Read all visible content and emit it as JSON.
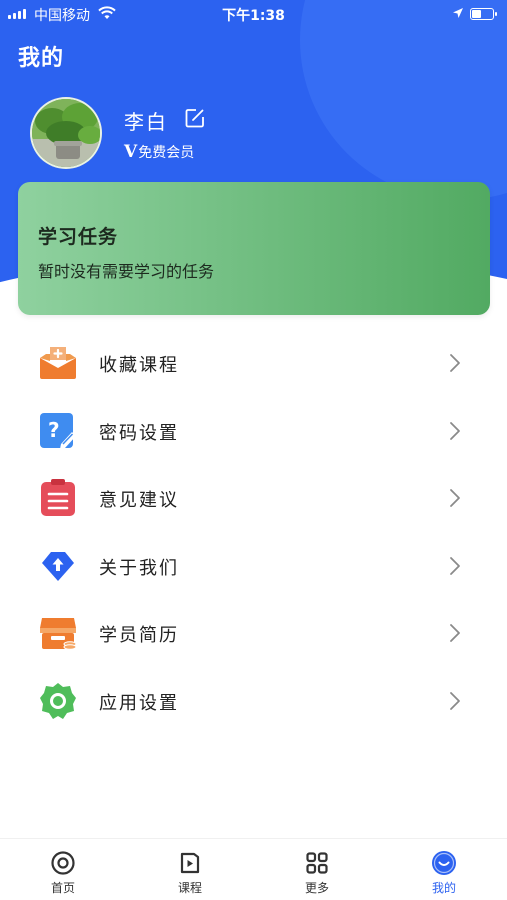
{
  "status_bar": {
    "carrier": "中国移动",
    "time": "下午1:38"
  },
  "header": {
    "title": "我的"
  },
  "profile": {
    "name": "李白",
    "membership": "免费会员",
    "vip_mark": "V"
  },
  "task_card": {
    "title": "学习任务",
    "description": "暂时没有需要学习的任务"
  },
  "menu": {
    "items": [
      {
        "label": "收藏课程",
        "icon": "favorite-course-icon"
      },
      {
        "label": "密码设置",
        "icon": "password-settings-icon"
      },
      {
        "label": "意见建议",
        "icon": "feedback-icon"
      },
      {
        "label": "关于我们",
        "icon": "about-us-icon"
      },
      {
        "label": "学员简历",
        "icon": "student-resume-icon"
      },
      {
        "label": "应用设置",
        "icon": "app-settings-icon"
      }
    ]
  },
  "tab_bar": {
    "tabs": [
      {
        "label": "首页",
        "icon": "home-icon"
      },
      {
        "label": "课程",
        "icon": "course-icon"
      },
      {
        "label": "更多",
        "icon": "more-icon"
      },
      {
        "label": "我的",
        "icon": "profile-icon",
        "active": true
      }
    ]
  },
  "colors": {
    "primary": "#2c62f0",
    "task_card_start": "#8fd19f",
    "task_card_end": "#52aa62"
  }
}
